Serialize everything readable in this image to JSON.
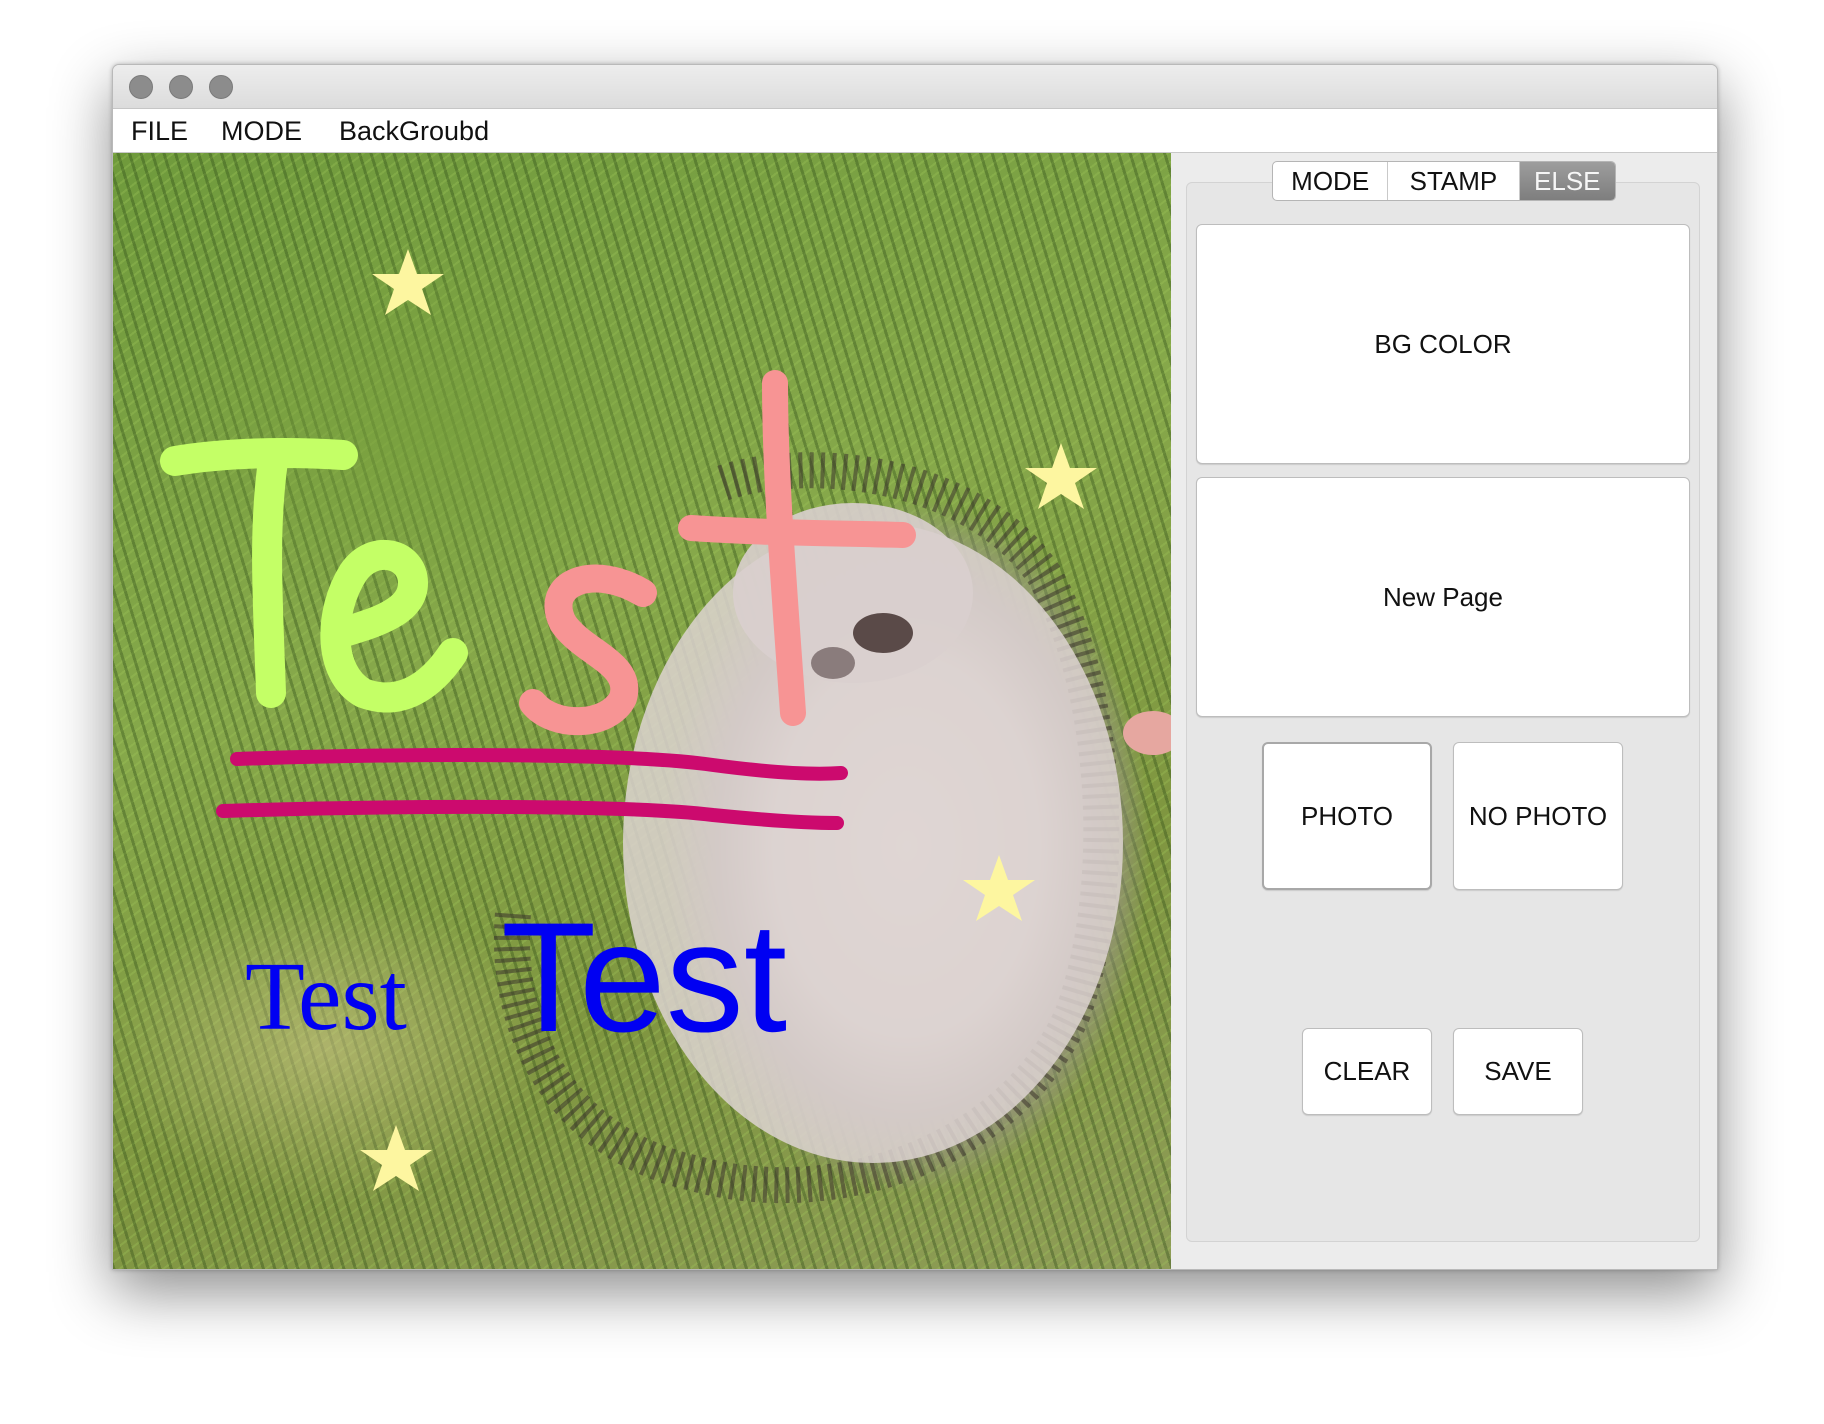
{
  "menu": {
    "items": [
      "FILE",
      "MODE",
      "BackGroubd"
    ]
  },
  "canvas": {
    "background_photo": "hedgehog lying in grass",
    "stroke_colors": {
      "green": "#c4ff66",
      "pink": "#f79494",
      "magenta": "#cc0a6e",
      "blue": "#0000f2",
      "star": "#fdf6a0"
    },
    "drawn_text_serif": "Test",
    "drawn_text_sans": "Test",
    "handwritten_text": "Test"
  },
  "tabs": {
    "items": [
      "MODE",
      "STAMP",
      "ELSE"
    ],
    "active": "ELSE"
  },
  "buttons": {
    "bg_color": "BG COLOR",
    "new_page": "New Page",
    "photo": "PHOTO",
    "no_photo": "NO PHOTO",
    "clear": "CLEAR",
    "save": "SAVE"
  }
}
